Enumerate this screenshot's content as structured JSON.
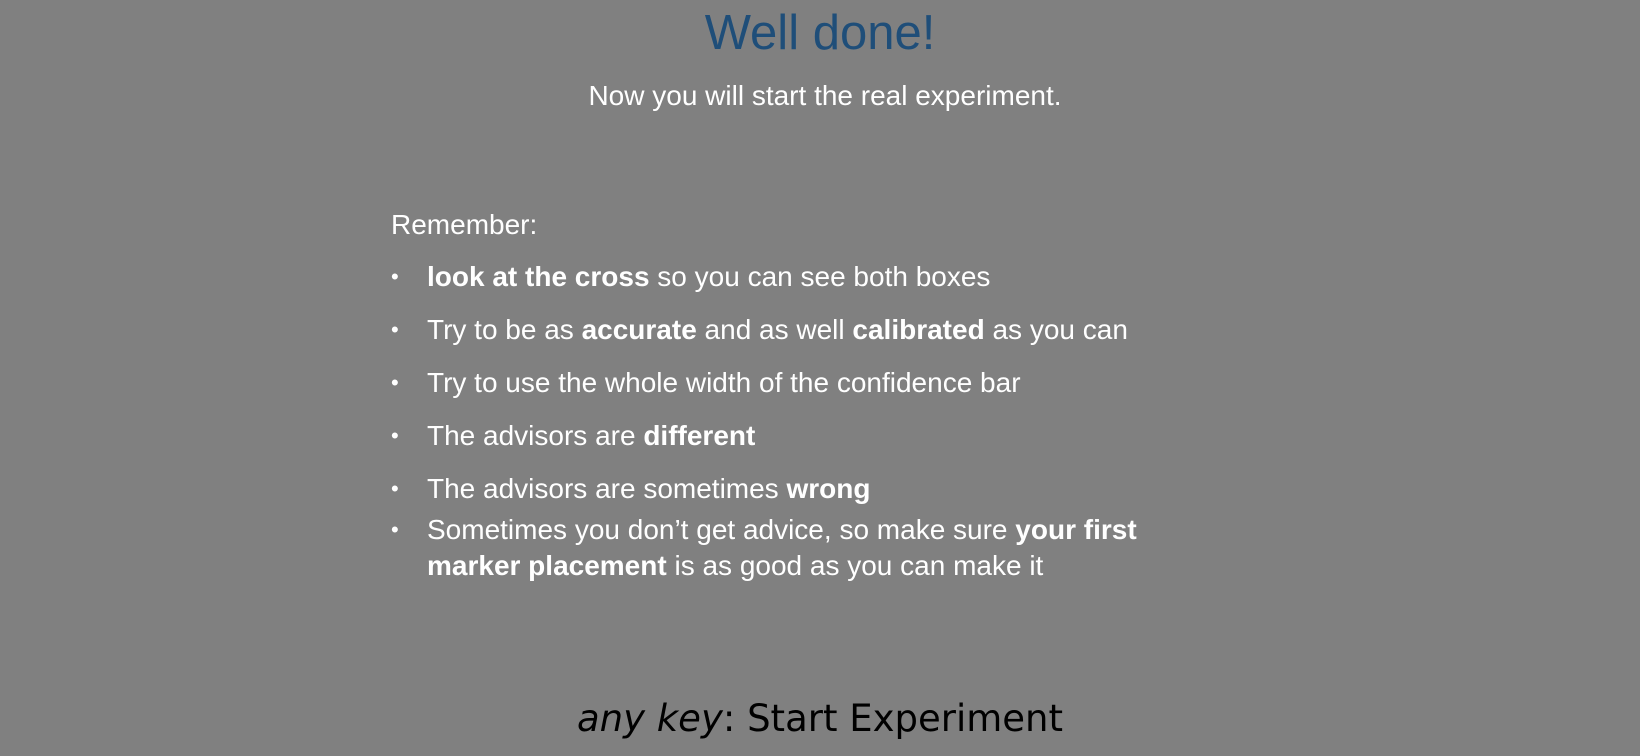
{
  "title": "Well done!",
  "subtitle": "Now you will start the real experiment.",
  "remember_label": "Remember:",
  "bullet_glyph": "•",
  "items": [
    {
      "parts": [
        {
          "text": "look at the cross",
          "bold": true
        },
        {
          "text": " so you can see both boxes",
          "bold": false
        }
      ]
    },
    {
      "parts": [
        {
          "text": "Try to be as ",
          "bold": false
        },
        {
          "text": "accurate",
          "bold": true
        },
        {
          "text": " and as well ",
          "bold": false
        },
        {
          "text": "calibrated",
          "bold": true
        },
        {
          "text": " as you can",
          "bold": false
        }
      ]
    },
    {
      "parts": [
        {
          "text": "Try to use the whole width of the confidence bar",
          "bold": false
        }
      ]
    },
    {
      "parts": [
        {
          "text": "The advisors are ",
          "bold": false
        },
        {
          "text": "different",
          "bold": true
        }
      ]
    },
    {
      "parts": [
        {
          "text": "The advisors are sometimes ",
          "bold": false
        },
        {
          "text": "wrong",
          "bold": true
        }
      ]
    },
    {
      "parts": [
        {
          "text": "Sometimes you don’t get advice, so make sure ",
          "bold": false
        },
        {
          "text": "your first marker placement",
          "bold": true
        },
        {
          "text": " is as good as you can make it",
          "bold": false
        }
      ]
    }
  ],
  "footer": {
    "key_label": "any key",
    "separator": ":",
    "action_label": " Start Experiment"
  },
  "colors": {
    "background": "#808080",
    "title": "#1f4e79",
    "text": "#ffffff",
    "footer_text": "#000000"
  }
}
